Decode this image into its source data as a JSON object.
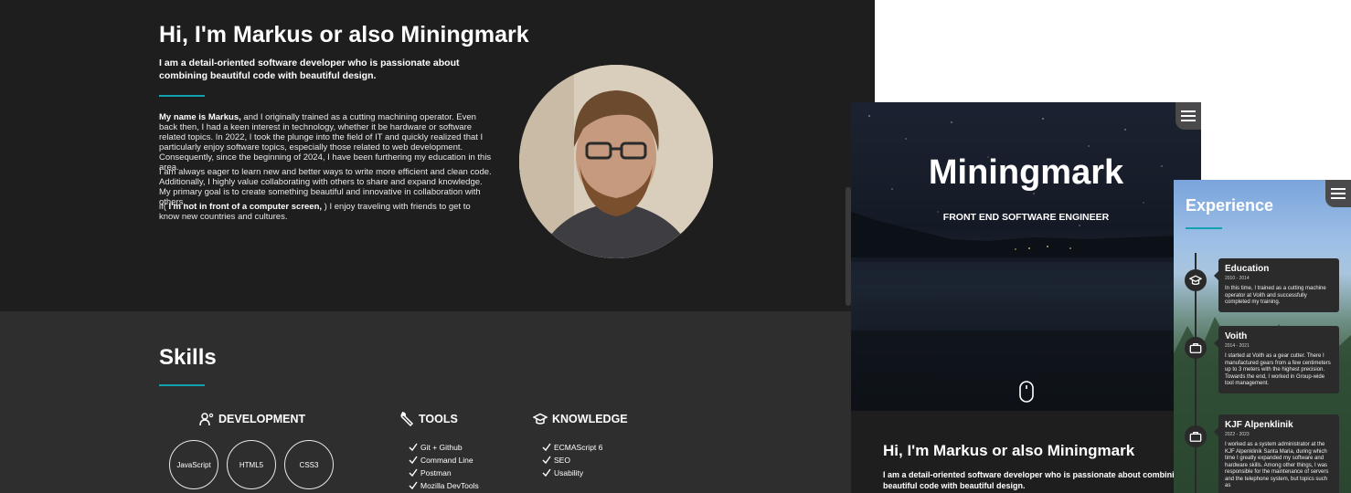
{
  "desktop": {
    "about": {
      "title": "Hi, I'm Markus or also Miningmark",
      "lead": "I am a detail-oriented software developer who is passionate about combining beautiful code with beautiful design.",
      "p1_bold": "My name is Markus,",
      "p1_text": " and I originally trained as a cutting machining operator. Even back then, I had a keen interest in technology, whether it be hardware or software related topics. In 2022, I took the plunge into the field of IT and quickly realized that I particularly enjoy software topics, especially those related to web development. Consequently, since the beginning of 2024, I have been furthering my education in this area.",
      "p2": "I am always eager to learn new and better ways to write more efficient and clean code. Additionally, I highly value collaborating with others to share and expand knowledge. My primary goal is to create something beautiful and innovative in collaboration with others.",
      "p3_pre": "if(",
      "p3_bold": " I'm not in front of a computer screen, ",
      "p3_text": ") I enjoy traveling with friends to get to know new countries and cultures."
    },
    "skills": {
      "title": "Skills",
      "development": {
        "label": "DEVELOPMENT",
        "items": [
          "JavaScript",
          "HTML5",
          "CSS3"
        ]
      },
      "tools": {
        "label": "TOOLS",
        "items": [
          "Git + Github",
          "Command Line",
          "Postman",
          "Mozilla DevTools"
        ]
      },
      "knowledge": {
        "label": "KNOWLEDGE",
        "items": [
          "ECMAScript 6",
          "SEO",
          "Usability"
        ]
      }
    }
  },
  "tablet": {
    "hero_title": "Miningmark",
    "hero_subtitle": "FRONT END SOFTWARE ENGINEER",
    "about_title": "Hi, I'm Markus or also Miningmark",
    "about_lead": "I am a detail-oriented software developer who is passionate about combining beautiful code with beautiful design."
  },
  "mobile": {
    "title": "Experience",
    "items": [
      {
        "title": "Education",
        "date": "2010 - 2014",
        "text": "In this time, I trained as a cutting machine operator at Voith and successfully completed my training."
      },
      {
        "title": "Voith",
        "date": "2014 - 2021",
        "text": "I started at Voith as a gear cutter. There I manufactured gears from a few centimeters up to 3 meters with the highest precision. Towards the end, I worked in Group-wide tool management."
      },
      {
        "title": "KJF Alpenklinik",
        "date": "2022 - 2023",
        "text": "I worked as a system administrator at the KJF Alpenklinik Santa Maria, during which time I greatly expanded my software and hardware skills. Among other things, I was responsible for the maintenance of servers and the telephone system, but topics such as"
      }
    ]
  },
  "colors": {
    "accent": "#13a0b0",
    "dark_bg": "#1e1e1f",
    "section_bg": "#2e2e2f"
  }
}
